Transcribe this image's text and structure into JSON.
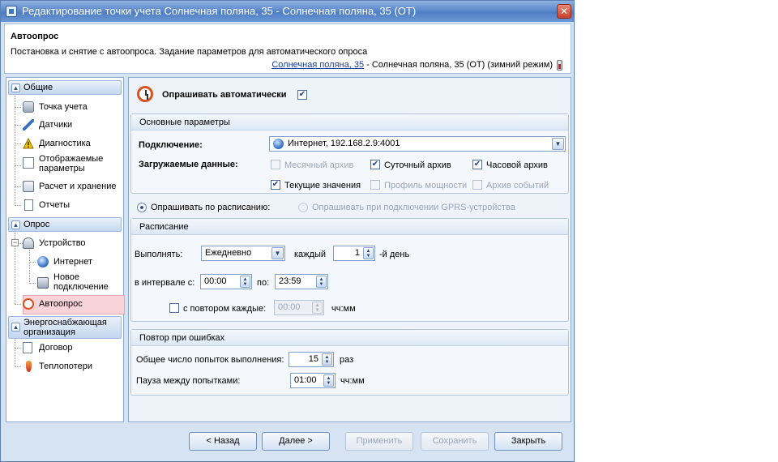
{
  "window": {
    "title": "Редактирование точки учета Солнечная поляна, 35 - Солнечная поляна, 35 (ОТ)",
    "close_glyph": "✕"
  },
  "header": {
    "title": "Автоопрос",
    "description": "Постановка и снятие с автоопроса. Задание параметров для автоматического опроса",
    "path_link": "Солнечная поляна, 35",
    "path_rest": " - Солнечная поляна, 35 (ОТ) (зимний режим)"
  },
  "nav": {
    "groups": [
      {
        "label": "Общие",
        "caret": "▲"
      },
      {
        "label": "Опрос",
        "caret": "▲"
      },
      {
        "label": "Энергоснабжающая организация",
        "caret": "▲"
      }
    ],
    "items": [
      {
        "label": "Точка учета",
        "icon": "meter-icon"
      },
      {
        "label": "Датчики",
        "icon": "pencil-icon"
      },
      {
        "label": "Диагностика",
        "icon": "warning-icon"
      },
      {
        "label": "Отображаемые параметры",
        "icon": "checklist-icon"
      },
      {
        "label": "Расчет и хранение",
        "icon": "calculator-icon"
      },
      {
        "label": "Отчеты",
        "icon": "document-icon"
      },
      {
        "label": "Устройство",
        "icon": "gauge-icon"
      },
      {
        "label": "Интернет",
        "icon": "globe-icon"
      },
      {
        "label": "Новое подключение",
        "icon": "connection-icon"
      },
      {
        "label": "Автоопрос",
        "icon": "alarm-clock-icon"
      },
      {
        "label": "Договор",
        "icon": "contract-icon"
      },
      {
        "label": "Теплопотери",
        "icon": "heat-loss-icon"
      }
    ]
  },
  "main": {
    "auto_poll_label": "Опрашивать автоматически",
    "auto_poll_checked": true,
    "basic": {
      "title": "Основные параметры",
      "connection_label": "Подключение:",
      "connection_value": "Интернет, 192.168.2.9:4001",
      "data_label": "Загружаемые данные:",
      "options": [
        {
          "label": "Месячный архив",
          "checked": false,
          "enabled": false
        },
        {
          "label": "Суточный архив",
          "checked": true,
          "enabled": true
        },
        {
          "label": "Часовой архив",
          "checked": true,
          "enabled": true
        },
        {
          "label": "Текущие значения",
          "checked": true,
          "enabled": true
        },
        {
          "label": "Профиль мощности",
          "checked": false,
          "enabled": false
        },
        {
          "label": "Архив событий",
          "checked": false,
          "enabled": false
        }
      ]
    },
    "mode": {
      "schedule_label": "Опрашивать по расписанию:",
      "gprs_label": "Опрашивать при подключении GPRS-устройства"
    },
    "schedule": {
      "title": "Расписание",
      "run_label": "Выполнять:",
      "run_value": "Ежедневно",
      "every_label": "каждый",
      "every_value": "1",
      "day_suffix": "-й день",
      "interval_label": "в интервале с:",
      "from_value": "00:00",
      "to_label": "по:",
      "to_value": "23:59",
      "repeat_label": "с повтором каждые:",
      "repeat_value": "00:00",
      "repeat_unit": "чч:мм"
    },
    "retry": {
      "title": "Повтор при ошибках",
      "attempts_label": "Общее число попыток выполнения:",
      "attempts_value": "15",
      "attempts_unit": "раз",
      "pause_label": "Пауза между попытками:",
      "pause_value": "01:00",
      "pause_unit": "чч:мм"
    }
  },
  "footer": {
    "back": "< Назад",
    "next": "Далее >",
    "apply": "Применить",
    "save": "Сохранить",
    "close": "Закрыть"
  },
  "glyphs": {
    "check": "✔",
    "dropdown": "▼",
    "spin_up": "▲",
    "spin_down": "▼",
    "minus": "−"
  }
}
